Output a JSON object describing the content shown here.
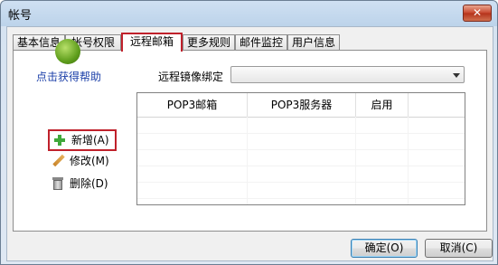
{
  "window": {
    "title": "帐号",
    "close_symbol": "✕"
  },
  "tabs": [
    {
      "label": "基本信息",
      "active": false
    },
    {
      "label": "帐号权限",
      "active": false
    },
    {
      "label": "远程邮箱",
      "active": true
    },
    {
      "label": "更多规则",
      "active": false
    },
    {
      "label": "邮件监控",
      "active": false
    },
    {
      "label": "用户信息",
      "active": false
    }
  ],
  "left_panel": {
    "logo_icon": "app-logo-icon",
    "help_label": "点击获得帮助",
    "actions": {
      "add": {
        "label": "新增(A)",
        "icon": "plus-icon"
      },
      "edit": {
        "label": "修改(M)",
        "icon": "pencil-icon"
      },
      "delete": {
        "label": "删除(D)",
        "icon": "trash-icon"
      }
    }
  },
  "mirror": {
    "label": "远程镜像绑定",
    "value": ""
  },
  "table": {
    "columns": [
      "POP3邮箱",
      "POP3服务器",
      "启用"
    ],
    "rows": []
  },
  "buttons": {
    "ok": "确定(O)",
    "cancel": "取消(C)"
  },
  "colors": {
    "highlight": "#c0212b",
    "link": "#1b3fa8"
  }
}
